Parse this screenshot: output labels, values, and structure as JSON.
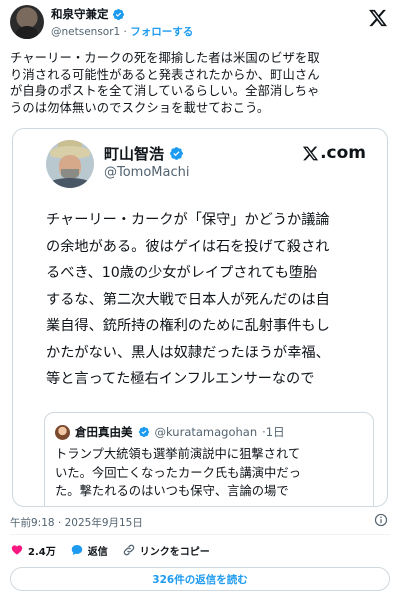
{
  "author": {
    "name": "和泉守兼定",
    "handle": "@netsensor1",
    "separator": " · ",
    "follow_label": "フォローする"
  },
  "tweet": {
    "lines": [
      "チャーリー・カークの死を揶揄した者は米国のビザを取",
      "り消される可能性があると発表されたからか、町山さん",
      "が自身のポストを全て消しているらしい。全部消しちゃ",
      "うのは勿体無いのでスクショを載せておこう。"
    ]
  },
  "screenshot": {
    "name": "町山智浩",
    "handle": "@TomoMachi",
    "brand": ".com",
    "lines": [
      "チャーリー・カークが「保守」かどうか議論",
      "の余地がある。彼はゲイは石を投げて殺され",
      "るべき、10歳の少女がレイプされても堕胎",
      "するな、第二次大戦で日本人が死んだのは自",
      "業自得、銃所持の権利のために乱射事件もし",
      "かたがない、黒人は奴隷だったほうが幸福、",
      "等と言ってた極右インフルエンサーなので"
    ],
    "quoted": {
      "name": "倉田真由美",
      "handle": "@kuratamagohan",
      "time": "·1日",
      "lines": [
        "トランプ大統領も選挙前演説中に狙撃されて",
        "いた。今回亡くなったカーク氏も講演中だっ",
        "た。撃たれるのはいつも保守、言論の場で"
      ]
    }
  },
  "meta": {
    "timestamp": "午前9:18 · 2025年9月15日"
  },
  "actions": {
    "like_count": "2.4万",
    "reply_label": "返信",
    "copy_link_label": "リンクをコピー"
  },
  "replies_button_label": "326件の返信を読む",
  "colors": {
    "accent": "#1d9bf0",
    "like": "#f91880",
    "text": "#0f1419",
    "secondary": "#536471",
    "border": "#cfd9de"
  },
  "icons": [
    "verified-badge-icon",
    "x-logo-icon",
    "info-icon",
    "heart-icon",
    "reply-icon",
    "link-icon"
  ]
}
